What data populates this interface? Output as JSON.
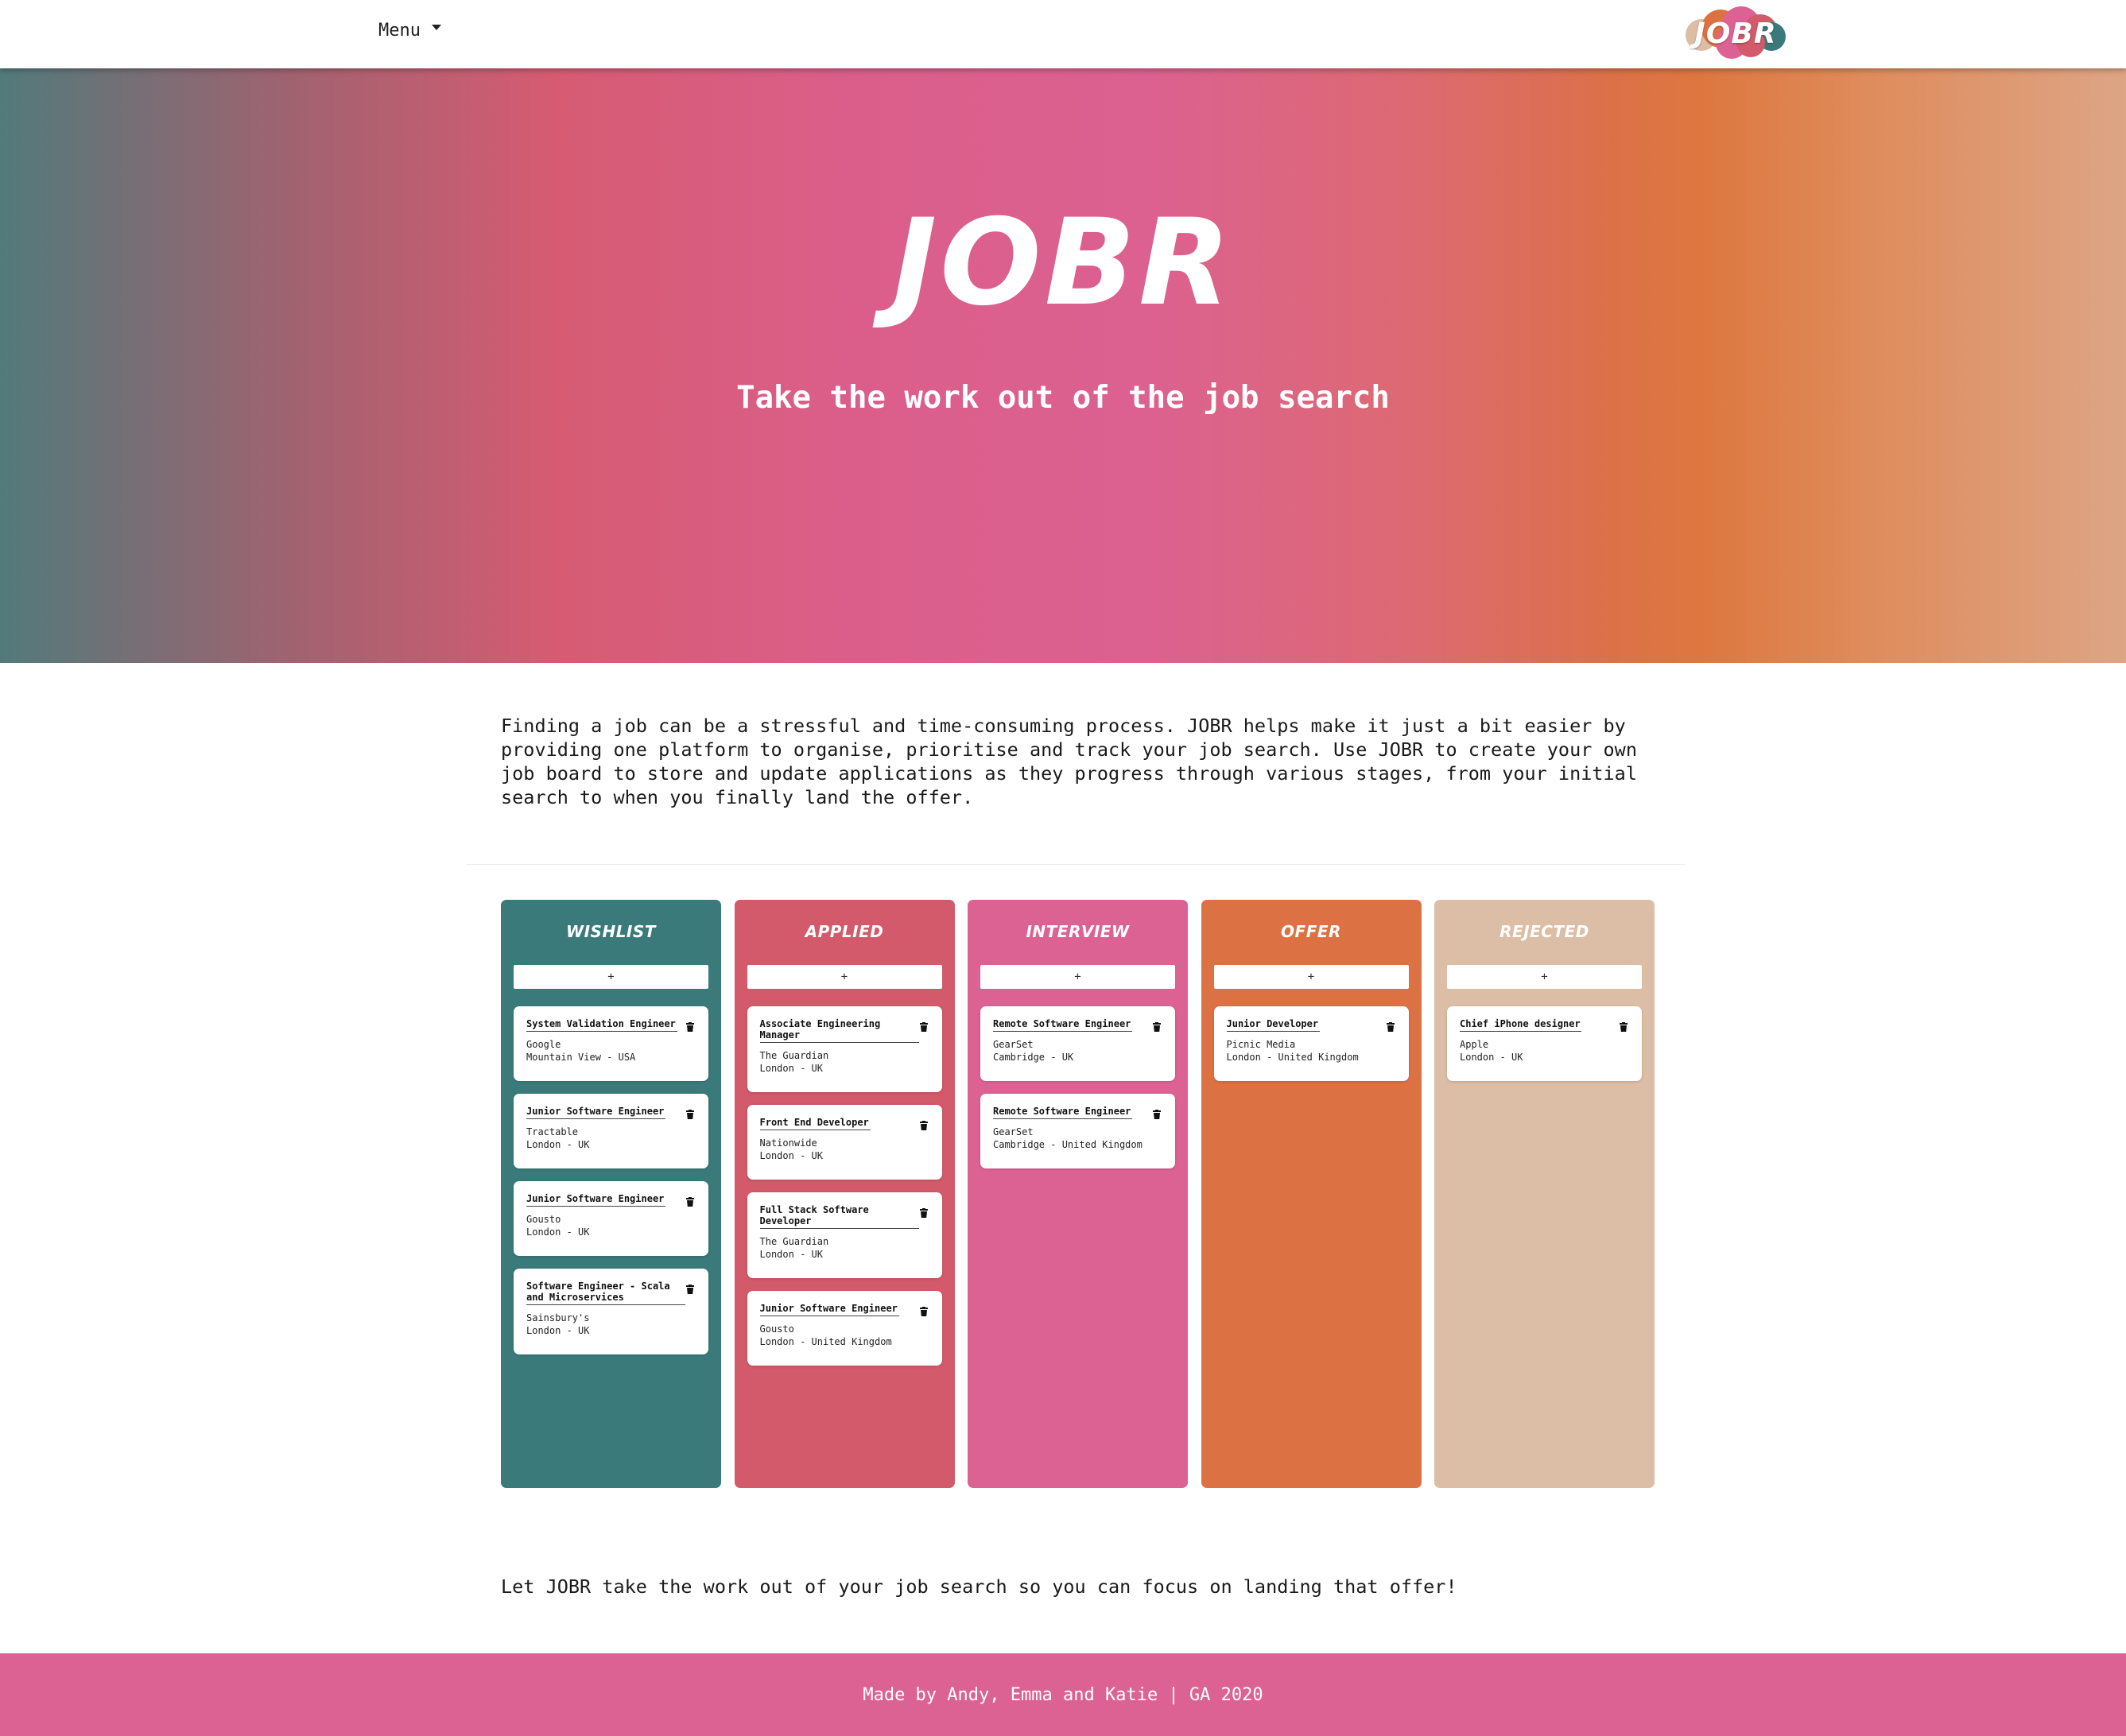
{
  "nav": {
    "menu_label": "Menu",
    "logo_text": "JOBR"
  },
  "hero": {
    "title": "JOBR",
    "subtitle": "Take the work out of the job search"
  },
  "intro": {
    "text": "Finding a job can be a stressful and time-consuming process. JOBR helps make it just a bit easier by providing one platform to organise, prioritise and track your job search. Use JOBR to create your own job board to store and update applications as they progress through various stages, from your initial search to when you finally land the offer."
  },
  "board": {
    "add_label": "+",
    "columns": [
      {
        "title": "WISHLIST",
        "color": "#3a7a7a",
        "cards": [
          {
            "title": "System Validation Engineer",
            "company": "Google",
            "location": "Mountain View - USA"
          },
          {
            "title": "Junior Software Engineer",
            "company": "Tractable",
            "location": "London - UK"
          },
          {
            "title": "Junior Software Engineer",
            "company": "Gousto",
            "location": "London - UK"
          },
          {
            "title": "Software Engineer - Scala and Microservices",
            "company": "Sainsbury's",
            "location": "London - UK"
          }
        ]
      },
      {
        "title": "APPLIED",
        "color": "#d25a6a",
        "cards": [
          {
            "title": "Associate Engineering Manager",
            "company": "The Guardian",
            "location": "London - UK"
          },
          {
            "title": "Front End Developer",
            "company": "Nationwide",
            "location": "London - UK"
          },
          {
            "title": "Full Stack Software Developer",
            "company": "The Guardian",
            "location": "London - UK"
          },
          {
            "title": "Junior Software Engineer",
            "company": "Gousto",
            "location": "London - United Kingdom"
          }
        ]
      },
      {
        "title": "INTERVIEW",
        "color": "#dd6294",
        "cards": [
          {
            "title": "Remote Software Engineer",
            "company": "GearSet",
            "location": "Cambridge - UK"
          },
          {
            "title": "Remote Software Engineer",
            "company": "GearSet",
            "location": "Cambridge - United Kingdom"
          }
        ]
      },
      {
        "title": "OFFER",
        "color": "#dc7243",
        "cards": [
          {
            "title": "Junior Developer",
            "company": "Picnic Media",
            "location": "London - United Kingdom"
          }
        ]
      },
      {
        "title": "REJECTED",
        "color": "#dcbda5",
        "cards": [
          {
            "title": "Chief iPhone designer",
            "company": "Apple",
            "location": "London - UK"
          }
        ]
      }
    ]
  },
  "outro": {
    "text": "Let JOBR take the work out of your job search so you can focus on landing that offer!"
  },
  "footer": {
    "text": "Made by Andy, Emma and Katie | GA 2020"
  },
  "icons": {
    "delete": "trash-icon",
    "dropdown": "caret-down-icon"
  }
}
